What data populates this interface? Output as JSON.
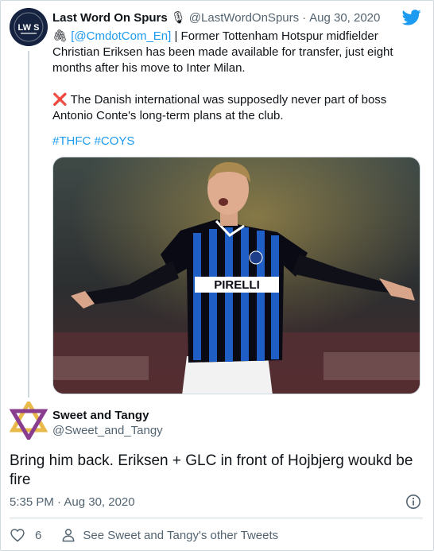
{
  "tweet": {
    "avatar_text": "LW S",
    "author_name": "Last Word On Spurs",
    "mic_emoji": "🎙",
    "handle": "@LastWordOnSpurs",
    "separator": "·",
    "date": "Aug 30, 2020",
    "pin_emoji": "🖇",
    "source_mention": "[@CmdotCom_En]",
    "line1_rest": " | Former Tottenham Hotspur midfielder Christian Eriksen has been made available for transfer, just eight months after his move to Inter Milan.",
    "cross_emoji": "❌",
    "line2": " The Danish international was supposedly never part of boss Antonio Conte's long-term plans at the club.",
    "hashtag1": "#THFC",
    "hashtag2": "#COYS",
    "photo_shirt_text": "PIRELLI"
  },
  "reply": {
    "author_name": "Sweet and Tangy",
    "handle": "@Sweet_and_Tangy",
    "text": "Bring him back. Eriksen + GLC in front of Hojbjerg woukd be fire",
    "timestamp": "5:35 PM · Aug 30, 2020",
    "like_count": "6",
    "other_tweets_label": "See Sweet and Tangy's other Tweets"
  },
  "icons": {
    "bird": "twitter-bird-icon",
    "info": "info-icon",
    "heart": "heart-icon",
    "person": "person-icon"
  },
  "colors": {
    "twitter_blue": "#1d9bf0",
    "text_primary": "#0f1419",
    "text_secondary": "#536471",
    "border": "#cfd9de",
    "cross_red": "#e0245e"
  }
}
